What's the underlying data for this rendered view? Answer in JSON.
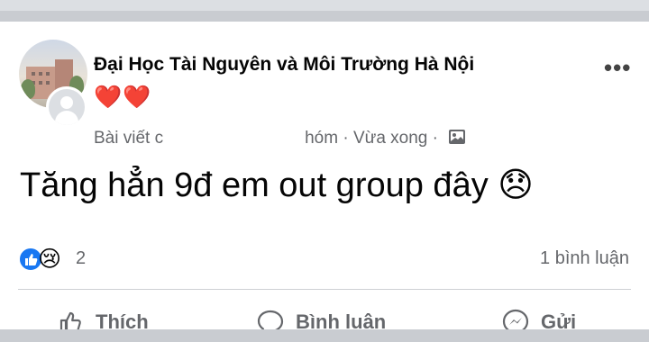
{
  "post": {
    "group_name": "Đại Học Tài Nguyên và Môi Trường Hà Nội",
    "author_reaction": "❤️❤️",
    "meta_left": "Bài viết c",
    "meta_right": "hóm · Vừa xong ·",
    "text": "Tăng hẳn 9đ em out group đây 😞",
    "more_label": "•••"
  },
  "stats": {
    "reaction_sad_emoji": "😢",
    "reaction_count": "2",
    "comment_count": "1 bình luận"
  },
  "actions": {
    "like_label": "Thích",
    "comment_label": "Bình luận",
    "share_label": "Gửi"
  },
  "colors": {
    "brand_blue": "#1877f2",
    "secondary_text": "#65676b",
    "heart_red": "#e41e3f"
  },
  "icons": [
    "like-icon",
    "sad-icon",
    "thumb-up-icon",
    "comment-icon",
    "messenger-icon",
    "photo-icon",
    "more-icon"
  ]
}
